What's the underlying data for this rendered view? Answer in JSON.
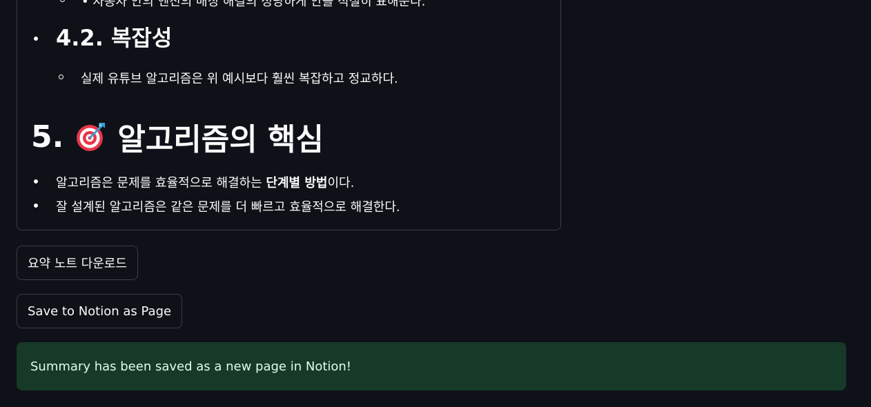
{
  "summary": {
    "cut_top_line": "• 자동차 안의 엔진의 매칭 해결의 정당하게 안을 적절히 표해준다.",
    "section_4_2": {
      "title": "4.2. 복잡성",
      "items": [
        "실제 유튜브 알고리즘은 위 예시보다 훨씬 복잡하고 정교하다."
      ]
    },
    "section_5": {
      "number": "5.",
      "icon": "target-icon",
      "title": "알고리즘의 핵심",
      "items": [
        {
          "before": "알고리즘은 문제를 효율적으로 해결하는 ",
          "bold": "단계별 방법",
          "after": "이다."
        },
        {
          "text": "잘 설계된 알고리즘은 같은 문제를 더 빠르고 효율적으로 해결한다."
        }
      ]
    }
  },
  "buttons": {
    "download_label": "요약 노트 다운로드",
    "notion_label": "Save to Notion as Page"
  },
  "alert": {
    "message": "Summary has been saved as a new page in Notion!"
  },
  "colors": {
    "background": "#0e1117",
    "border": "#3b3e46",
    "success_bg": "#173928",
    "success_text": "#dffde9"
  }
}
